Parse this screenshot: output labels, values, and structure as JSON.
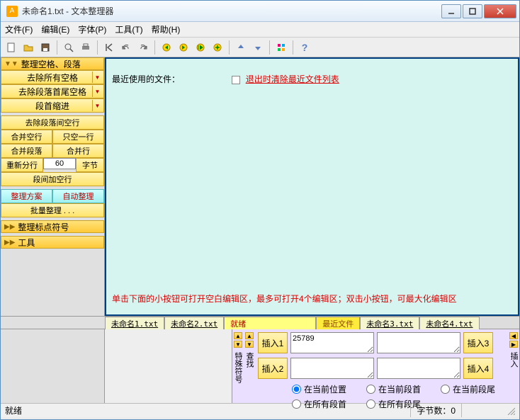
{
  "window": {
    "title": "未命名1.txt - 文本整理器"
  },
  "menu": {
    "file": "文件(F)",
    "edit": "编辑(E)",
    "font": "字体(P)",
    "tools": "工具(T)",
    "help": "帮助(H)"
  },
  "sidebar": {
    "group1": {
      "header": "整理空格、段落",
      "remove_all_spaces": "去除所有空格",
      "remove_trail_spaces": "去除段落首尾空格",
      "indent": "段首缩进",
      "remove_blank_lines": "去除段落间空行",
      "merge_blank": "合并空行",
      "only_one_line": "只空一行",
      "merge_para": "合并段落",
      "merge_line": "合并行",
      "resplit": "重新分行",
      "resplit_num": "60",
      "bytes": "字节",
      "add_blank": "段间加空行",
      "plan": "整理方案",
      "auto": "自动整理",
      "batch": "批量整理 . . ."
    },
    "group2": {
      "header": "整理标点符号"
    },
    "group3": {
      "header": "工具"
    }
  },
  "content": {
    "recent_label": "最近使用的文件：",
    "clear_on_exit": "退出时清除最近文件列表",
    "bottom_msg": "单击下面的小按钮可打开空白编辑区，最多可打开4个编辑区；双击小按钮，可最大化编辑区"
  },
  "tabs": {
    "t1": "未命名1.txt",
    "t2": "未命名2.txt",
    "ready": "就绪",
    "recent": "最近文件",
    "t3": "未命名3.txt",
    "t4": "未命名4.txt"
  },
  "lower": {
    "side1": "特殊符号",
    "side2": "查找",
    "side3": "插入",
    "insert1": "插入1",
    "insert2": "插入2",
    "insert3": "插入3",
    "insert4": "插入4",
    "val1": "25789",
    "r1": "在当前位置",
    "r2": "在当前段首",
    "r3": "在当前段尾",
    "r4": "在所有段首",
    "r5": "在所有段尾"
  },
  "status": {
    "ready": "就绪",
    "bytes": "字节数：0"
  }
}
